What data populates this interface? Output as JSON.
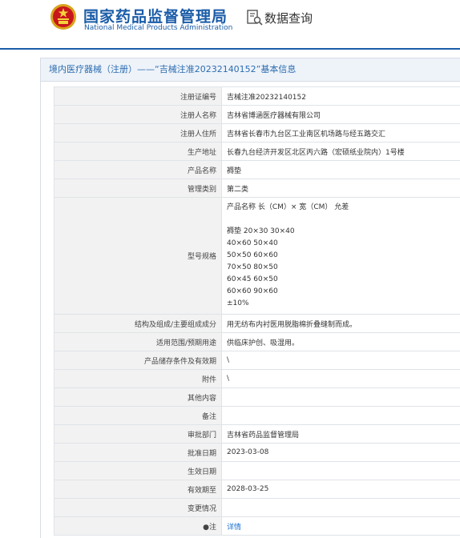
{
  "header": {
    "brand_cn": "国家药品监督管理局",
    "brand_en": "National Medical Products Administration",
    "query_label": "数据查询",
    "brand_color": "#1a5ca8"
  },
  "panel": {
    "title": "境内医疗器械（注册）——“吉械注准20232140152”基本信息"
  },
  "rows": [
    {
      "label": "注册证编号",
      "value": "吉械注准20232140152"
    },
    {
      "label": "注册人名称",
      "value": "吉林省博涵医疗器械有限公司"
    },
    {
      "label": "注册人住所",
      "value": "吉林省长春市九台区工业南区机场路与经五路交汇"
    },
    {
      "label": "生产地址",
      "value": "长春九台经济开发区北区丙六路（宏硕纸业院内）1号楼"
    },
    {
      "label": "产品名称",
      "value": "褥垫"
    },
    {
      "label": "管理类别",
      "value": "第二类"
    },
    {
      "label": "型号规格",
      "lines": [
        "产品名称 长（CM）× 宽（CM） 允差",
        "",
        "褥垫 20×30 30×40",
        "40×60 50×40",
        "50×50 60×60",
        "70×50 80×50",
        "60×45 60×50",
        "60×60 90×60",
        "±10%"
      ]
    },
    {
      "label": "结构及组成/主要组成成分",
      "value": "用无纺布内衬医用脱脂棉折叠缝制而成。"
    },
    {
      "label": "适用范围/预期用途",
      "value": "供临床护创、吸湿用。"
    },
    {
      "label": "产品储存条件及有效期",
      "value": "\\"
    },
    {
      "label": "附件",
      "value": "\\"
    },
    {
      "label": "其他内容",
      "value": ""
    },
    {
      "label": "备注",
      "value": ""
    },
    {
      "label": "审批部门",
      "value": "吉林省药品监督管理局"
    },
    {
      "label": "批准日期",
      "value": "2023-03-08"
    },
    {
      "label": "生效日期",
      "value": ""
    },
    {
      "label": "有效期至",
      "value": "2028-03-25"
    },
    {
      "label": "变更情况",
      "value": ""
    },
    {
      "label": "●注",
      "value": "详情"
    }
  ]
}
